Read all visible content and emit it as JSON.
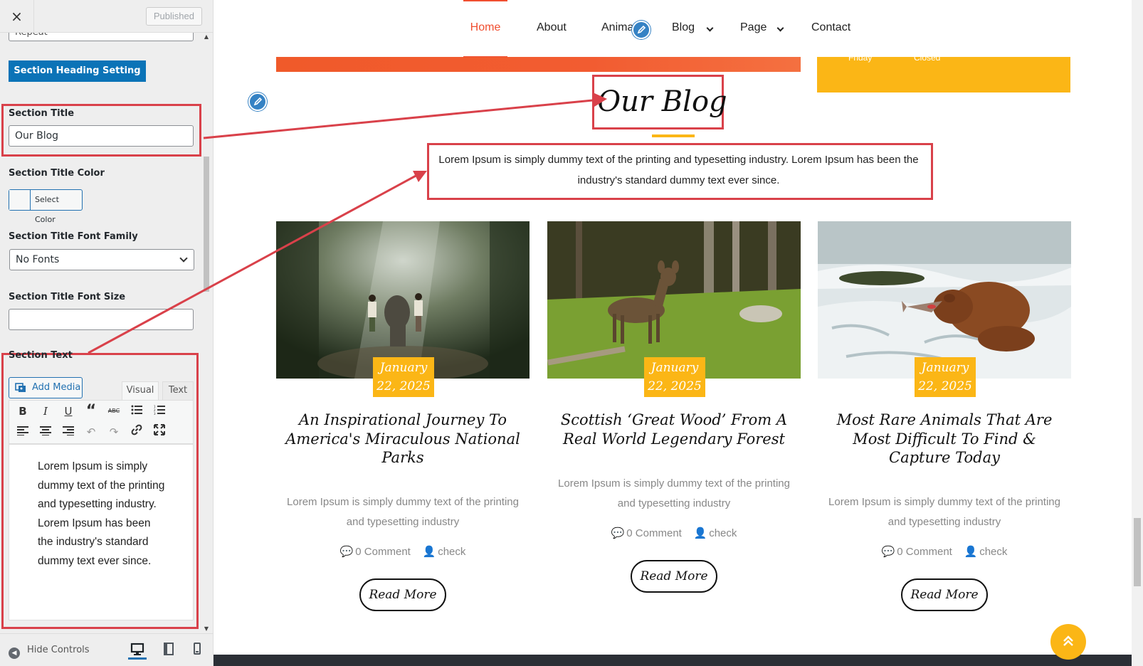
{
  "customizer": {
    "close_icon": "×",
    "publish_label": "Published",
    "repeat_value": "Repeat",
    "heading_setting_label": "Section Heading Setting",
    "title_label": "Section Title",
    "title_value": "Our Blog",
    "title_color_label": "Section Title Color",
    "select_color_label": "Select Color",
    "font_family_label": "Section Title Font Family",
    "font_family_value": "No Fonts",
    "font_size_label": "Section Title Font Size",
    "font_size_value": "",
    "text_label": "Section Text",
    "add_media_label": "Add Media",
    "tab_visual": "Visual",
    "tab_text": "Text",
    "editor_content": "Lorem Ipsum is simply dummy text of the printing and typesetting industry. Lorem Ipsum has been the industry's standard dummy text ever since.",
    "hide_controls_label": "Hide Controls",
    "toolbar_icons": [
      "bold-icon",
      "italic-icon",
      "underline-icon",
      "blockquote-icon",
      "strikethrough-icon",
      "bullet-list-icon",
      "numbered-list-icon",
      "align-left-icon",
      "align-center-icon",
      "align-right-icon",
      "undo-icon",
      "redo-icon",
      "link-icon",
      "fullscreen-icon"
    ]
  },
  "nav": {
    "items": [
      {
        "label": "Home",
        "active": true
      },
      {
        "label": "About"
      },
      {
        "label": "Anima"
      },
      {
        "label": "Blog",
        "dropdown": true
      },
      {
        "label": "Page",
        "dropdown": true
      },
      {
        "label": "Contact"
      }
    ]
  },
  "hours": {
    "day": "Friday",
    "status": "Closed"
  },
  "section": {
    "title": "Our Blog",
    "text": "Lorem Ipsum is simply dummy text of the printing and typesetting industry. Lorem Ipsum has been the industry's standard dummy text ever since."
  },
  "posts": [
    {
      "date_line1": "January",
      "date_line2": "22, 2025",
      "title": "An Inspirational Journey To America's Miraculous National Parks",
      "excerpt": "Lorem Ipsum is simply dummy text of the printing and typesetting industry",
      "comments": "0 Comment",
      "author": "check",
      "read_more": "Read More",
      "image": "children-with-elephant-in-forest"
    },
    {
      "date_line1": "January",
      "date_line2": "22, 2025",
      "title": "Scottish ‘Great Wood’ From A Real World Legendary Forest",
      "excerpt": "Lorem Ipsum is simply dummy text of the printing and typesetting industry",
      "comments": "0 Comment",
      "author": "check",
      "read_more": "Read More",
      "image": "deer-in-green-forest"
    },
    {
      "date_line1": "January",
      "date_line2": "22, 2025",
      "title": "Most Rare Animals That Are Most Difficult To Find & Capture Today",
      "excerpt": "Lorem Ipsum is simply dummy text of the printing and typesetting industry",
      "comments": "0 Comment",
      "author": "check",
      "read_more": "Read More",
      "image": "bear-catching-salmon"
    }
  ],
  "colors": {
    "accent_orange": "#f04e30",
    "accent_yellow": "#fbb616",
    "highlight_red": "#d9414a",
    "wp_blue": "#0b73b7"
  },
  "icons": {
    "scroll_top": "scroll-top-icon",
    "comment": "comment-icon",
    "author": "user-icon",
    "edit": "pencil-icon"
  }
}
